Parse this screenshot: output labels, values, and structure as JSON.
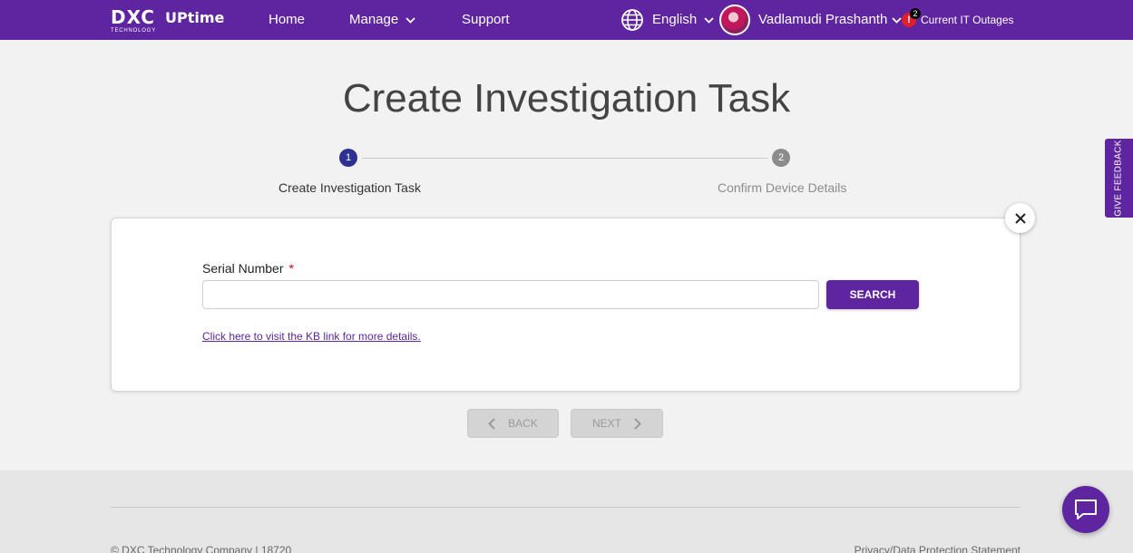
{
  "header": {
    "logo_text": "DXC",
    "logo_subtext": "TECHNOLOGY",
    "app_name": "UPtime",
    "nav": [
      {
        "label": "Home"
      },
      {
        "label": "Manage"
      },
      {
        "label": "Support"
      }
    ],
    "language": "English",
    "user_name": "Vadlamudi Prashanth",
    "outages": {
      "count": "2",
      "label": "Current IT Outages",
      "alert_symbol": "!"
    }
  },
  "page": {
    "title": "Create Investigation Task"
  },
  "stepper": {
    "steps": [
      {
        "number": "1",
        "label": "Create Investigation Task",
        "state": "active"
      },
      {
        "number": "2",
        "label": "Confirm Device Details",
        "state": "inactive"
      }
    ]
  },
  "form": {
    "serial_label": "Serial Number",
    "required_mark": "*",
    "serial_value": "",
    "serial_placeholder": "",
    "search_label": "SEARCH",
    "kb_link": "Click here to visit the KB link for more details."
  },
  "actions": {
    "back_label": "BACK",
    "next_label": "NEXT"
  },
  "footer": {
    "copyright": "© DXC Technology Company | 18720",
    "privacy": "Privacy/Data Protection Statement"
  },
  "feedback_label": "GIVE FEEDBACK",
  "colors": {
    "brand": "#5f249f",
    "step_active": "#2e3192",
    "step_inactive": "#8c8c8c",
    "alert": "#e0202c"
  }
}
